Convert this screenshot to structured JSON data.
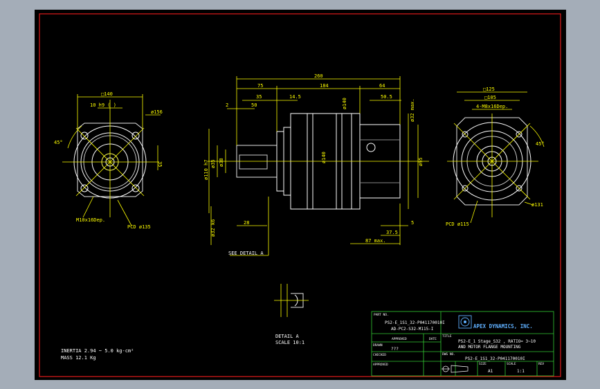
{
  "dims": {
    "flange_square": "□140",
    "shaft_keyway": "10 h9 (    )",
    "pcd_left_dia": "ø156",
    "angle": "45°",
    "dim_35": "35",
    "tap": "M10x16Dep.",
    "pcd_left": "PCD ø135",
    "overall": "260",
    "d75": "75",
    "d184": "184",
    "d64": "64",
    "d35": "35",
    "d145": "14.5",
    "d505": "50.5",
    "d2": "2",
    "d50": "50",
    "d140": "ø140",
    "d32max": "ø32 max.",
    "d95": "ø95",
    "d140b": "ø140",
    "d110": "ø110 h7",
    "d35b": "ø35",
    "d38": "ø38",
    "d32k": "ø32 k6",
    "d28": "28",
    "d5": "5",
    "d375": "37.5",
    "d87": "87 max.",
    "see_detail": "SEE DETAIL A",
    "sq125": "□125",
    "sq105": "□105",
    "tap_right": "4-M8x16Dep.",
    "angle_r": "45°",
    "dia131": "ø131",
    "pcd_right": "PCD ø115"
  },
  "detail": {
    "label": "DETAIL A",
    "scale": "SCALE 10:1"
  },
  "notes": {
    "inertia": "INERTIA  2.94 ~ 5.0 kg-cm²",
    "mass": "MASS  12.1  Kg"
  },
  "title_block": {
    "part_no_label": "PART NO.",
    "part_no_1": "PS2-E_1S1_32-P041170010I",
    "part_no_2": "AD-PC2-S32-M115-I",
    "approved_label": "APPROVED",
    "date_label": "DATE",
    "drawn_label": "DRAWN",
    "drawn_value": "???",
    "checked_label": "CHECKED",
    "approved2_label": "APPROVED",
    "company": "APEX DYNAMICS, INC.",
    "title_label": "TITLE",
    "title_1": "PS2-E_1 Stage_S32 , RATIO= 3~10",
    "title_2": "AND MOTOR FLANGE MOUNTING",
    "dwg_label": "DWG NO.",
    "dwg_value": "PS2-E_1S1_32-P041170010I",
    "size_label": "SIZE",
    "size_value": "A1",
    "scale_label": "SCALE",
    "scale_value": "1:1",
    "rev_label": "REV"
  }
}
